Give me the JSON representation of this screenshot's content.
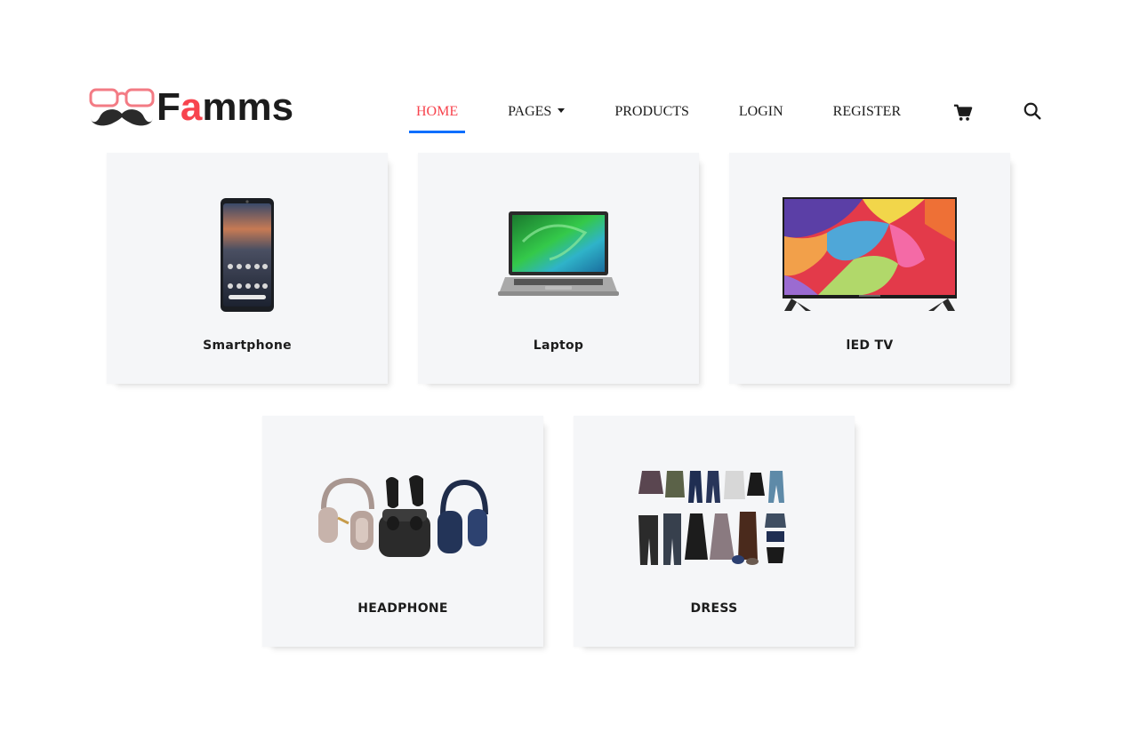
{
  "brand": {
    "name_prefix": "F",
    "name_accent": "a",
    "name_suffix": "mms",
    "accent_color": "#f7444e",
    "logo_icon": "glasses-mustache-icon"
  },
  "nav": {
    "home": "HOME",
    "pages": "PAGES",
    "products": "PRODUCTS",
    "login": "LOGIN",
    "register": "REGISTER",
    "cart_icon": "cart-icon",
    "search_icon": "search-icon",
    "active_underline_color": "#0d6efd"
  },
  "categories": [
    {
      "label": "Smartphone",
      "icon": "smartphone-icon"
    },
    {
      "label": "Laptop",
      "icon": "laptop-icon"
    },
    {
      "label": "lED TV",
      "icon": "tv-icon"
    },
    {
      "label": "HEADPHONE",
      "icon": "headphone-icon"
    },
    {
      "label": "DRESS",
      "icon": "dress-icon"
    }
  ]
}
